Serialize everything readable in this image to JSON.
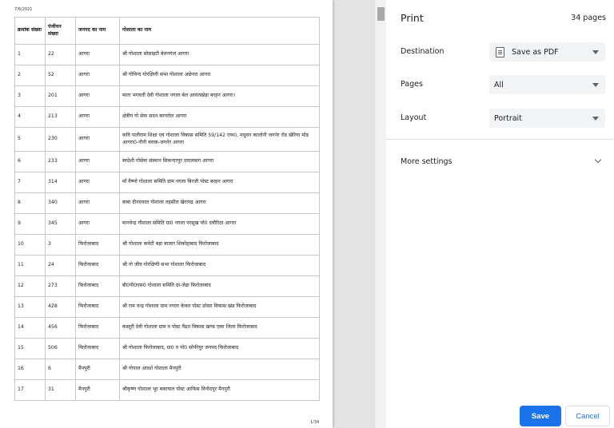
{
  "preview": {
    "date": "7/6/2021",
    "page_number": "1/34",
    "columns": [
      "क्रमांक संख्या",
      "पंजीयन संख्या",
      "जनपद का नाम",
      "गोशाला का नाम"
    ],
    "rows": [
      [
        "1",
        "22",
        "आगरा",
        "श्री गोशाला सोसाइटी बेलनगंज आगरा"
      ],
      [
        "2",
        "52",
        "आगरा",
        "श्री गोविन्द गोरक्षिणी सभा गोशाला अछेनरा आगरा"
      ],
      [
        "3",
        "201",
        "आगरा",
        "माता भगवती देवी गोशाला नगला बेल आवंलखेड़ा बरहन आगरा।"
      ],
      [
        "4",
        "213",
        "आगरा",
        "क्षेत्रीय गो सेवा सदन कागरोल आगरा"
      ],
      [
        "5",
        "230",
        "आगरा",
        "कवि पातीराम शिक्षा एवं गोशाला विकास समिति 59/142 एफ0, मधुवन कालोनी जगनेर रोड खेरिया मोड़ आगरा0-नौनी ब्लाक-जगनेर आगरा"
      ],
      [
        "6",
        "233",
        "आगरा",
        "स्वदेशी गोसेवा संस्थान सिकन्दरपुर दयालबाग आगरा"
      ],
      [
        "7",
        "314",
        "आगरा",
        "माँ वैष्णो गोशाला समिति ग्राम नगला बिरजी पोस्ट बरहन आगरा"
      ],
      [
        "8",
        "340",
        "आगरा",
        "बाबा दीनदयाल गोशाला तहसील खेरागढ़ आगरा"
      ],
      [
        "9",
        "345",
        "आगरा",
        "मानवेन्द्र गौशाला समिति ग्रा0 नगला परसुख पो0 दयौरिठा आगरा"
      ],
      [
        "10",
        "3",
        "फिरोजाबाद",
        "श्री गोशाला कमेटी बड़ा बाजार शिकोहाबाद फिरोजाबाद"
      ],
      [
        "11",
        "24",
        "फिरोजाबाद",
        "श्री गो जीव गोरक्षिणी सभा गोशाला फिरोजाबाद"
      ],
      [
        "12",
        "273",
        "फिरोजाबाद",
        "बी0पी0एस0 गोशाला समिति ग्रा-जेड़ा फिरोजाबाद"
      ],
      [
        "13",
        "428",
        "फिरोजाबाद",
        "श्री राम चन्द्र गोशाला ग्राम नगला केवल पोस्ट उरेसर विकास खंड फिरोजाबाद"
      ],
      [
        "14",
        "456",
        "फिरोजाबाद",
        "कस्तूरी देवी गोशाला ग्राम व पोस्ट पैढत विकास खण्ड एका जिला फिरोजाबाद"
      ],
      [
        "15",
        "506",
        "फिरोजाबाद",
        "श्री गोशाला फिरोजाबाद, ग्रा0 व पो0 सोफीपुर जनपद फिरोजाबाद"
      ],
      [
        "16",
        "6",
        "मैनपुरी",
        "श्री गोपाल आदर्श गोशाला मैनपुरी"
      ],
      [
        "17",
        "31",
        "मैनपुरी",
        "श्रीकृष्ण गोशाला भूर बकायात पोस्ट आफिस विनोदपुर मैनपुरी"
      ]
    ]
  },
  "panel": {
    "title": "Print",
    "page_count": "34 pages",
    "destination_label": "Destination",
    "destination_value": "Save as PDF",
    "pages_label": "Pages",
    "pages_value": "All",
    "layout_label": "Layout",
    "layout_value": "Portrait",
    "more_settings": "More settings",
    "save": "Save",
    "cancel": "Cancel"
  },
  "icons": {
    "pdf": "document-icon",
    "dropdown": "caret-down-icon",
    "expand": "chevron-down-icon"
  },
  "colors": {
    "accent": "#1a73e8",
    "select_bg": "#f1f3f4"
  }
}
